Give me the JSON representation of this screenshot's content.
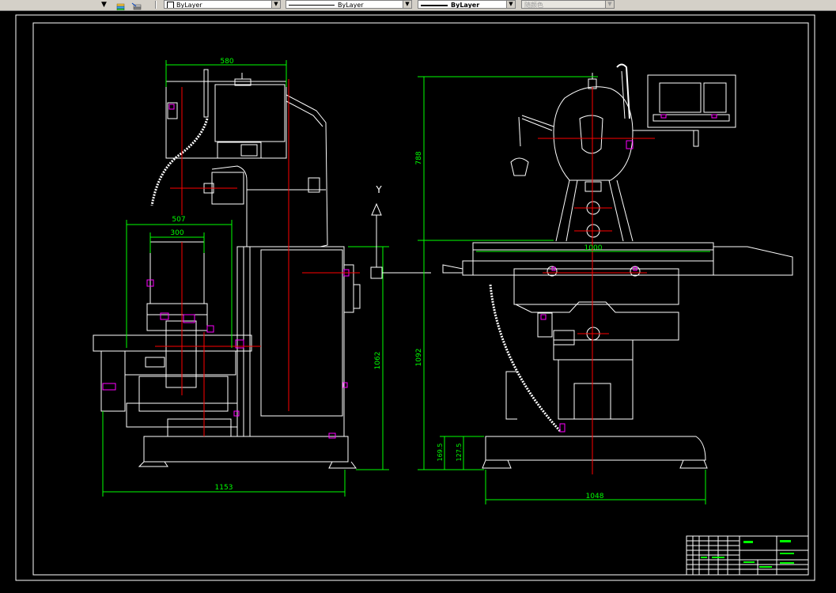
{
  "toolbar": {
    "layer_manager_icon": "layer-stack-icon",
    "layer_state_icon": "layer-state-icon",
    "color_combo": {
      "value": "ByLayer"
    },
    "linetype_combo": {
      "value": "ByLayer"
    },
    "lineweight_combo": {
      "value": "ByLayer"
    },
    "plotstyle_combo": {
      "value": "随颜色"
    }
  },
  "drawing": {
    "side_view_dims": {
      "width_top": "580",
      "width_mid": "507",
      "width_inner": "300",
      "height_right": "1062",
      "base_width": "1153"
    },
    "front_view_dims": {
      "height_top": "788",
      "table_length": "1000",
      "height_total": "1092",
      "base_h1": "169.5",
      "base_h2": "127.5",
      "base_width": "1048"
    },
    "ucs_label": "Y"
  },
  "colors": {
    "background": "#000000",
    "geometry": "#ffffff",
    "dimension": "#00ff00",
    "centerline": "#ff0000",
    "accent": "#ff00ff",
    "ucs": "#ffffff"
  }
}
